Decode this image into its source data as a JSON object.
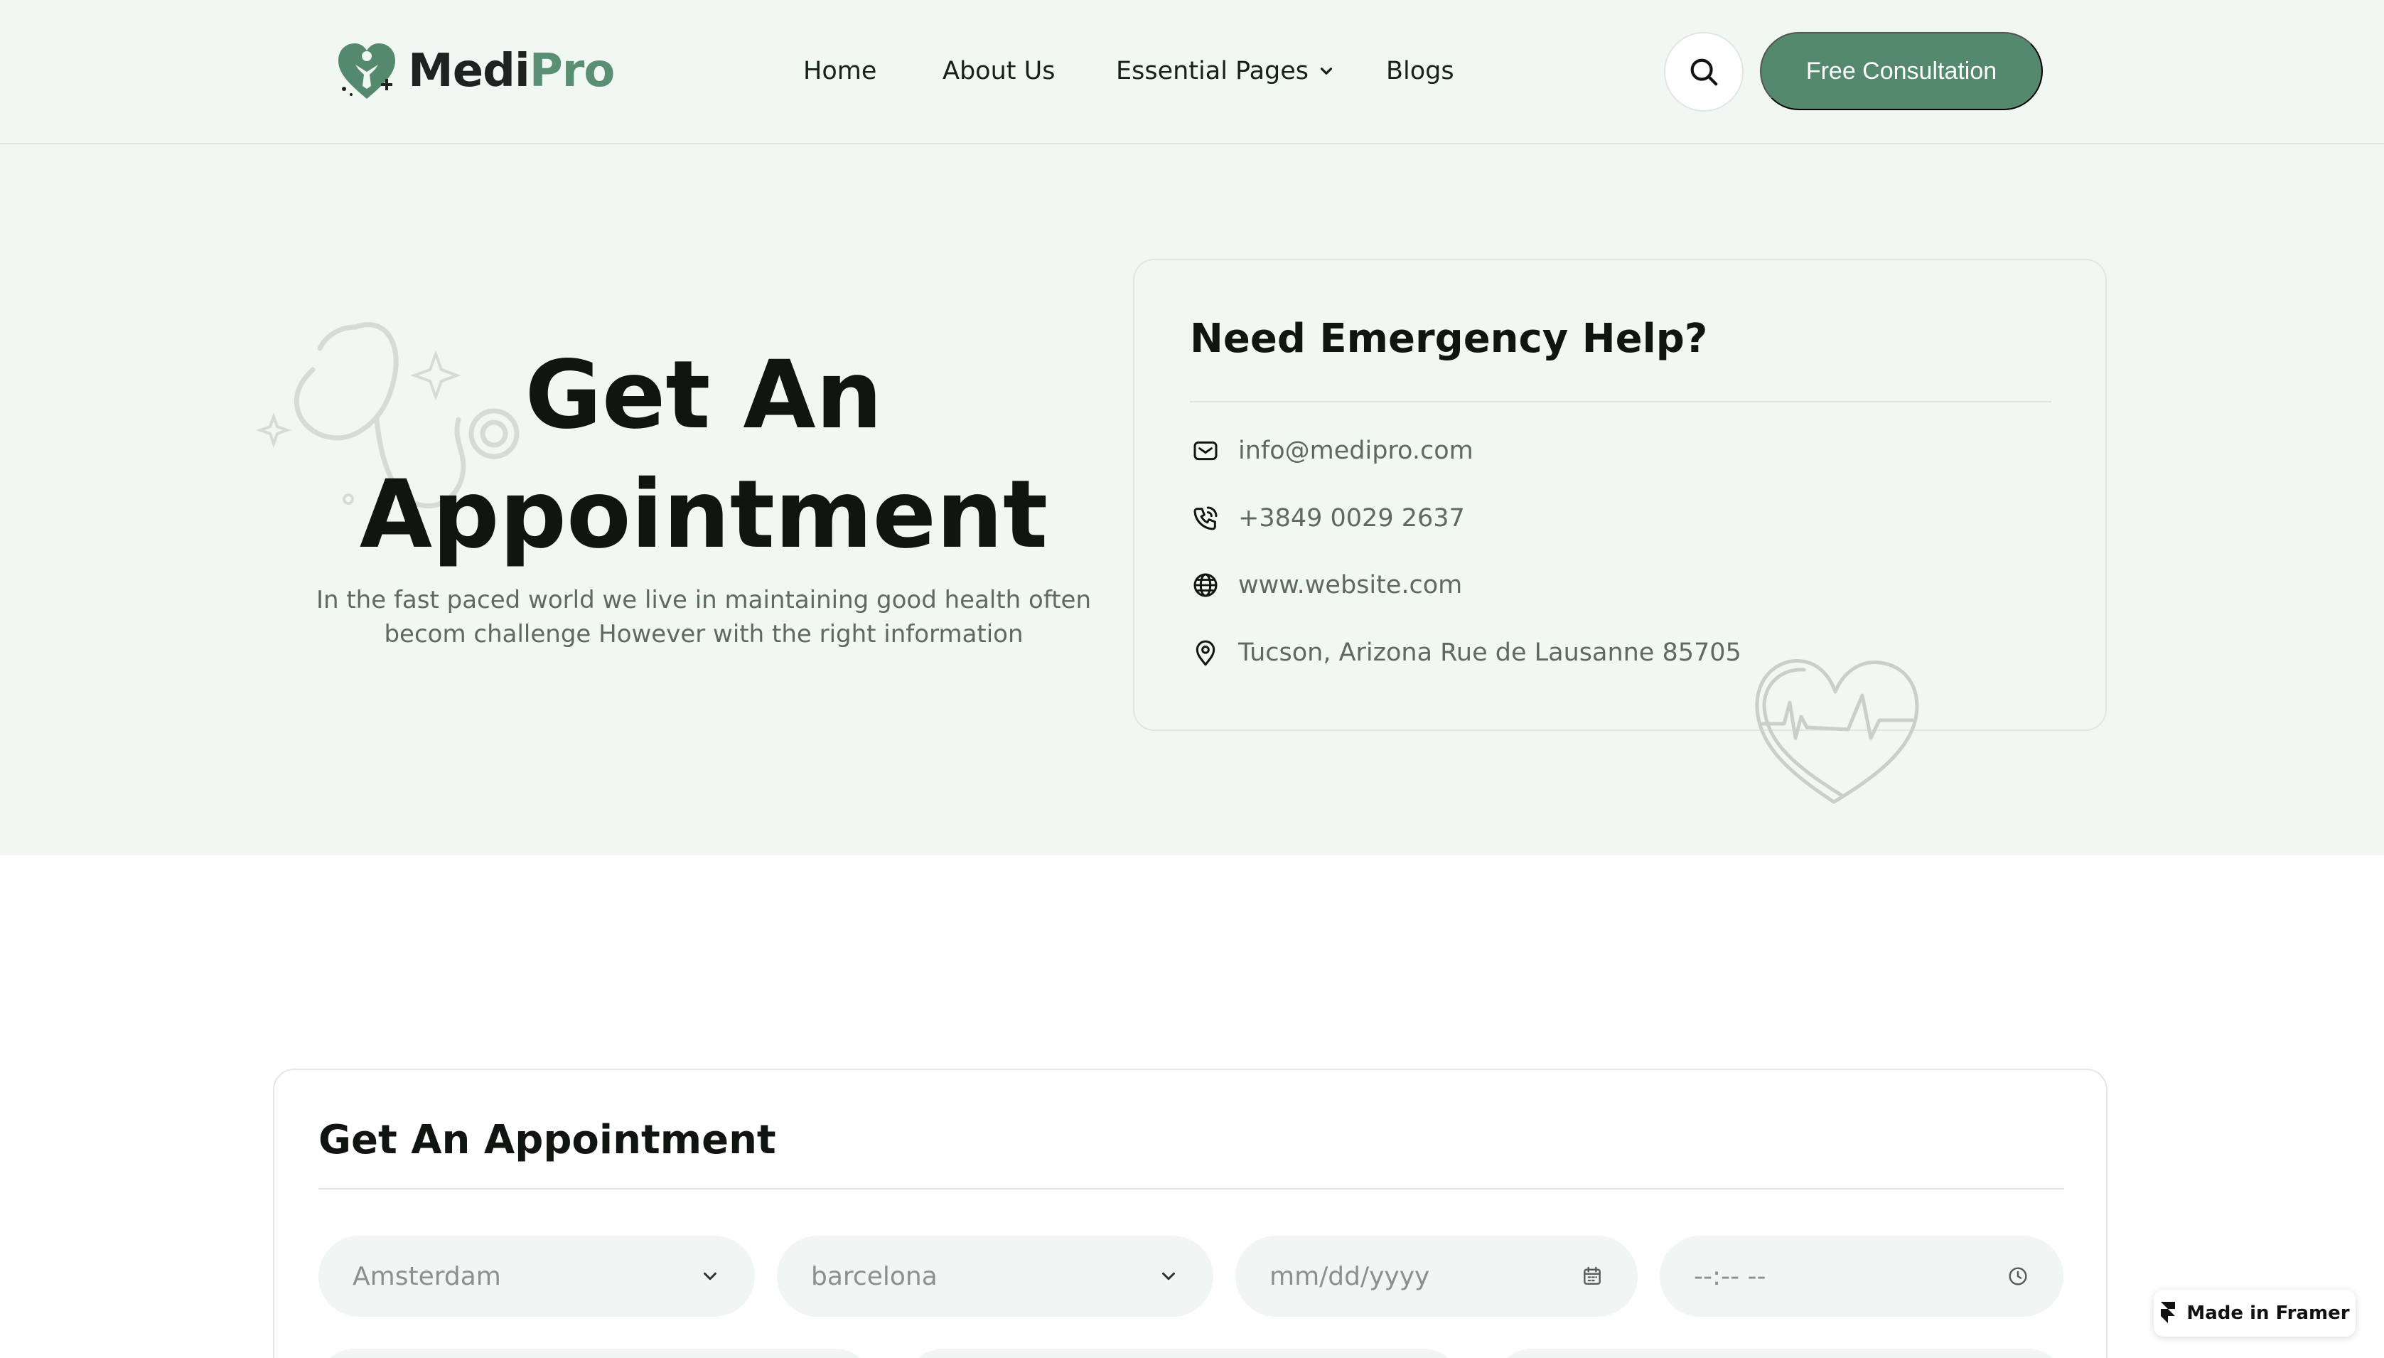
{
  "header": {
    "logo": {
      "part1": "Medi",
      "part2": "Pro"
    },
    "nav": [
      {
        "label": "Home"
      },
      {
        "label": "About Us"
      },
      {
        "label": "Essential Pages"
      },
      {
        "label": "Blogs"
      }
    ],
    "cta_label": "Free Consultation"
  },
  "hero": {
    "title_line1": "Get An",
    "title_line2": "Appointment",
    "subtitle_line1": "In the fast paced world we live in maintaining good health often",
    "subtitle_line2": "becom challenge However with the right information"
  },
  "emergency": {
    "title": "Need Emergency Help?",
    "email": "info@medipro.com",
    "phone": "+3849 0029 2637",
    "website": "www.website.com",
    "address": "Tucson, Arizona Rue de Lausanne 85705"
  },
  "form": {
    "title": "Get An Appointment",
    "from_value": "Amsterdam",
    "to_value": "barcelona",
    "date_placeholder": "mm/dd/yyyy",
    "time_placeholder": "--:-- --"
  },
  "badge": {
    "label": "Made in Framer"
  },
  "colors": {
    "brand": "#55896d",
    "hero_bg": "#f1f7f3",
    "text": "#101512",
    "muted": "#5f6863"
  }
}
